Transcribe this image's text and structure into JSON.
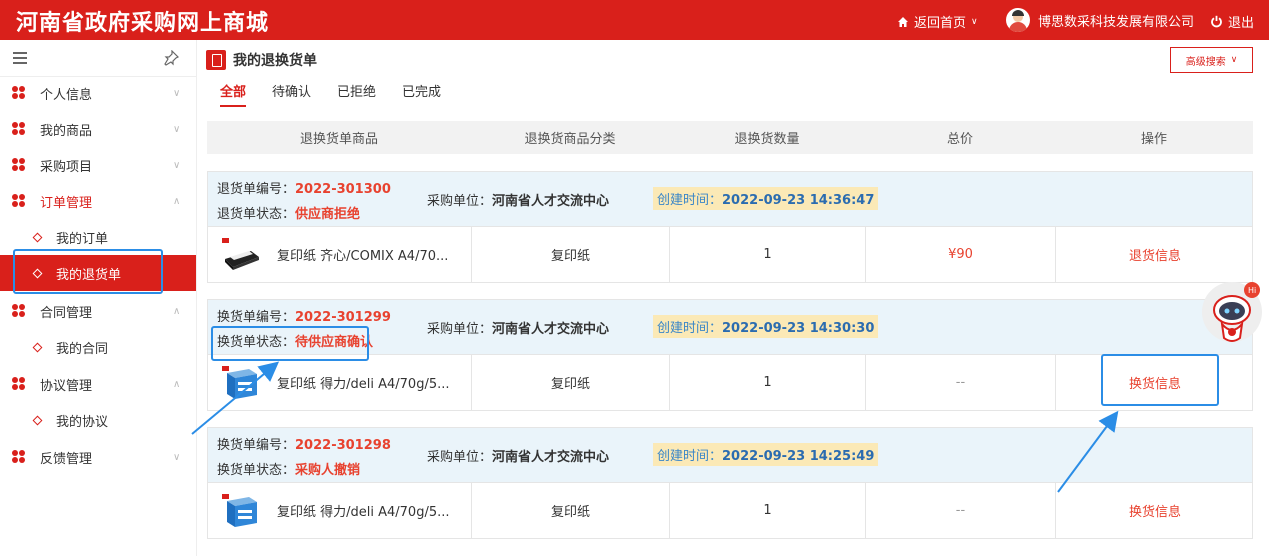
{
  "header": {
    "site_title": "河南省政府采购网上商城",
    "home_link": "返回首页",
    "company": "博思数采科技发展有限公司",
    "logout": "退出"
  },
  "sidebar": {
    "items": [
      {
        "label": "个人信息"
      },
      {
        "label": "我的商品"
      },
      {
        "label": "采购项目"
      },
      {
        "label": "订单管理",
        "children": [
          {
            "label": "我的订单"
          },
          {
            "label": "我的退货单"
          }
        ]
      },
      {
        "label": "合同管理",
        "children": [
          {
            "label": "我的合同"
          }
        ]
      },
      {
        "label": "协议管理",
        "children": [
          {
            "label": "我的协议"
          }
        ]
      },
      {
        "label": "反馈管理"
      }
    ]
  },
  "page": {
    "title": "我的退换货单",
    "advanced_search": "高级搜索",
    "tabs": [
      "全部",
      "待确认",
      "已拒绝",
      "已完成"
    ]
  },
  "table": {
    "columns": [
      "退换货单商品",
      "退换货商品分类",
      "退换货数量",
      "总价",
      "操作"
    ]
  },
  "orders": [
    {
      "no_label": "退货单编号：",
      "no": "2022-301300",
      "status_label": "退货单状态：",
      "status": "供应商拒绝",
      "buyer_label": "采购单位：",
      "buyer": "河南省人才交流中心",
      "created_label": "创建时间：",
      "created": "2022-09-23 14:36:47",
      "product": "复印纸 齐心/COMIX A4/70...",
      "category": "复印纸",
      "qty": "1",
      "price": "¥90",
      "action": "退货信息"
    },
    {
      "no_label": "换货单编号：",
      "no": "2022-301299",
      "status_label": "换货单状态：",
      "status": "待供应商确认",
      "buyer_label": "采购单位：",
      "buyer": "河南省人才交流中心",
      "created_label": "创建时间：",
      "created": "2022-09-23 14:30:30",
      "product": "复印纸 得力/deli A4/70g/5...",
      "category": "复印纸",
      "qty": "1",
      "price": "--",
      "action": "换货信息"
    },
    {
      "no_label": "换货单编号：",
      "no": "2022-301298",
      "status_label": "换货单状态：",
      "status": "采购人撤销",
      "buyer_label": "采购单位：",
      "buyer": "河南省人才交流中心",
      "created_label": "创建时间：",
      "created": "2022-09-23 14:25:49",
      "product": "复印纸 得力/deli A4/70g/5...",
      "category": "复印纸",
      "qty": "1",
      "price": "--",
      "action": "换货信息"
    }
  ],
  "colors": {
    "brand_red": "#d9201b",
    "highlight_blue": "#2b8de6",
    "order_header_bg": "#eaf4fa",
    "created_bg": "#fbe9b6"
  }
}
